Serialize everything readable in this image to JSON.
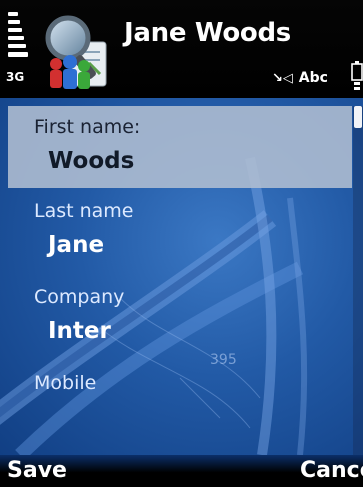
{
  "statusbar": {
    "network": "3G",
    "signal_icon": "signal-strength-icon",
    "battery_icon": "battery-icon"
  },
  "header": {
    "title": "Jane Woods",
    "app_icon": "contacts-search-icon",
    "input_mode": "Abc",
    "input_mode_icon": "pen-icon"
  },
  "form": {
    "fields": [
      {
        "label": "First name:",
        "value": "Woods",
        "focused": true
      },
      {
        "label": "Last name",
        "value": "Jane",
        "focused": false
      },
      {
        "label": "Company",
        "value": "Inter",
        "focused": false
      },
      {
        "label": "Mobile",
        "value": "",
        "focused": false
      }
    ],
    "background_map_label": "395"
  },
  "softkeys": {
    "left": "Save",
    "right": "Cancel"
  },
  "colors": {
    "background_top": "#3b78c4",
    "background_bottom": "#113f84",
    "focus_highlight": "#b0bed2",
    "text": "#ffffff"
  }
}
